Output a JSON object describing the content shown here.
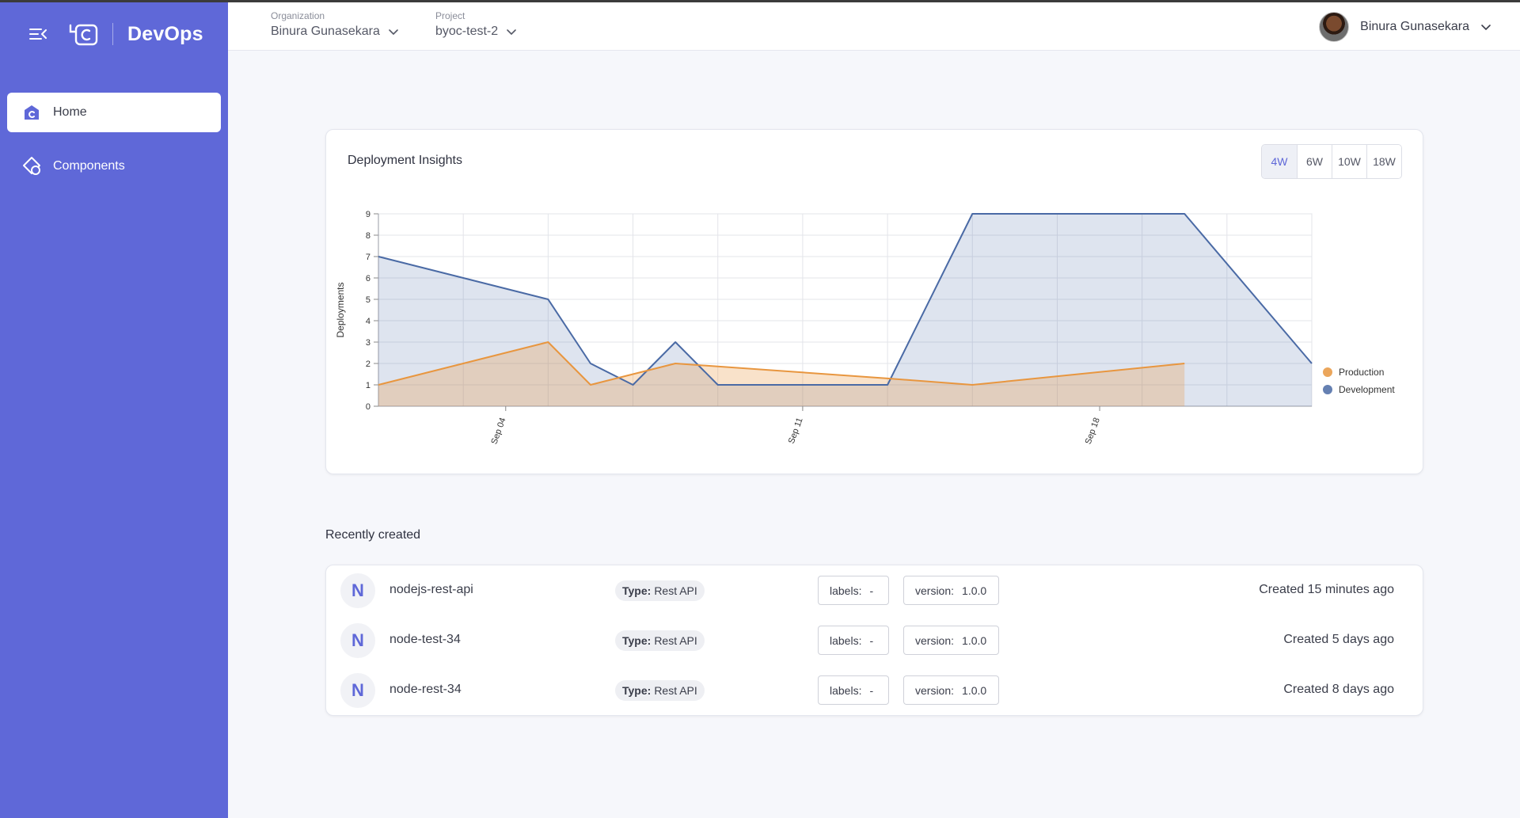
{
  "app": {
    "brand_name": "DevOps"
  },
  "sidebar": {
    "items": [
      {
        "label": "Home",
        "icon": "home-icon",
        "active": true
      },
      {
        "label": "Components",
        "icon": "components-icon",
        "active": false
      }
    ]
  },
  "header": {
    "organization": {
      "label": "Organization",
      "value": "Binura Gunasekara"
    },
    "project": {
      "label": "Project",
      "value": "byoc-test-2"
    },
    "user": {
      "name": "Binura Gunasekara"
    }
  },
  "insights": {
    "title": "Deployment Insights",
    "ranges": [
      "4W",
      "6W",
      "10W",
      "18W"
    ],
    "selected_range": "4W"
  },
  "chart_data": {
    "type": "area",
    "title": "Deployment Insights",
    "ylabel": "Deployments",
    "xlabel": "",
    "ylim": [
      0,
      9
    ],
    "yticks": [
      0,
      1,
      2,
      3,
      4,
      5,
      6,
      7,
      8,
      9
    ],
    "x_tick_labels": [
      "Sep 04",
      "Sep 11",
      "Sep 18"
    ],
    "x_tick_positions": [
      1.5,
      5,
      8.5
    ],
    "x_range": [
      0,
      11
    ],
    "grid": true,
    "legend_position": "right",
    "series": [
      {
        "name": "Production",
        "color": "#e8963f",
        "x": [
          0,
          2,
          2.5,
          3.5,
          6,
          7,
          9.5
        ],
        "y": [
          1,
          3,
          1,
          2,
          1.3,
          1,
          2
        ]
      },
      {
        "name": "Development",
        "color": "#4a6aa5",
        "x": [
          0,
          1,
          2,
          2.5,
          3,
          3.5,
          4,
          6,
          7,
          8,
          9,
          9.5,
          11
        ],
        "y": [
          7,
          6,
          5,
          2,
          1,
          3,
          1,
          1,
          9,
          9,
          9,
          9,
          2
        ]
      }
    ]
  },
  "recent": {
    "title": "Recently created",
    "items": [
      {
        "initial": "N",
        "name": "nodejs-rest-api",
        "type_key": "Type:",
        "type_value": "Rest API",
        "labels_key": "labels:",
        "labels_value": "-",
        "version_key": "version:",
        "version_value": "1.0.0",
        "created": "Created 15 minutes ago"
      },
      {
        "initial": "N",
        "name": "node-test-34",
        "type_key": "Type:",
        "type_value": "Rest API",
        "labels_key": "labels:",
        "labels_value": "-",
        "version_key": "version:",
        "version_value": "1.0.0",
        "created": "Created 5 days ago"
      },
      {
        "initial": "N",
        "name": "node-rest-34",
        "type_key": "Type:",
        "type_value": "Rest API",
        "labels_key": "labels:",
        "labels_value": "-",
        "version_key": "version:",
        "version_value": "1.0.0",
        "created": "Created 8 days ago"
      }
    ]
  },
  "colors": {
    "sidebar": "#5f68d8",
    "accent": "#5f68d8",
    "production": "#e8963f",
    "development": "#4a6aa5"
  }
}
